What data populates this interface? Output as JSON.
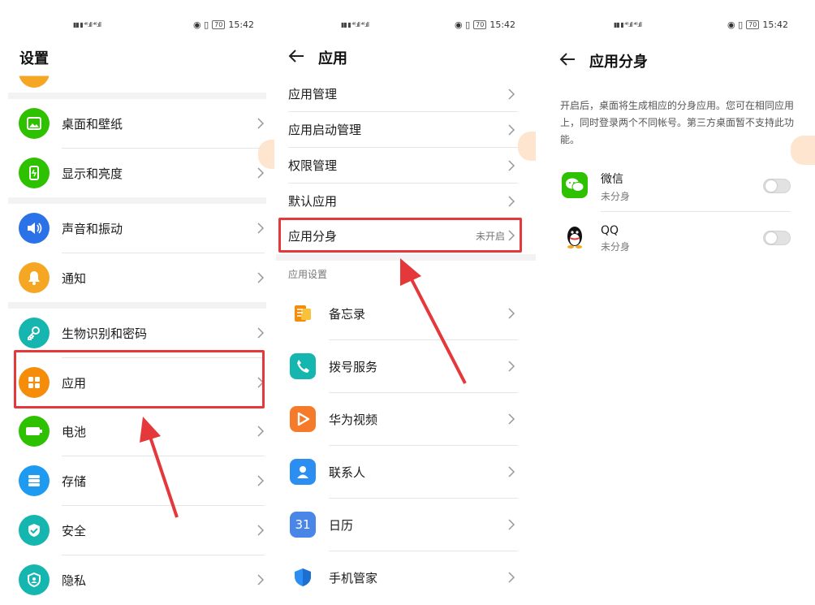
{
  "status": {
    "time": "15:42",
    "battery": "70"
  },
  "panel1": {
    "title": "设置",
    "items": [
      {
        "label": "桌面和壁纸"
      },
      {
        "label": "显示和亮度"
      },
      {
        "label": "声音和振动"
      },
      {
        "label": "通知"
      },
      {
        "label": "生物识别和密码"
      },
      {
        "label": "应用"
      },
      {
        "label": "电池"
      },
      {
        "label": "存储"
      },
      {
        "label": "安全"
      },
      {
        "label": "隐私"
      }
    ]
  },
  "panel2": {
    "title": "应用",
    "menu": [
      {
        "label": "应用管理"
      },
      {
        "label": "应用启动管理"
      },
      {
        "label": "权限管理"
      },
      {
        "label": "默认应用"
      }
    ],
    "clone": {
      "label": "应用分身",
      "value": "未开启"
    },
    "section": "应用设置",
    "apps": [
      {
        "label": "备忘录"
      },
      {
        "label": "拨号服务"
      },
      {
        "label": "华为视频"
      },
      {
        "label": "联系人"
      },
      {
        "label": "日历",
        "icon_text": "31"
      },
      {
        "label": "手机管家"
      }
    ]
  },
  "panel3": {
    "title": "应用分身",
    "description": "开启后，桌面将生成相应的分身应用。您可在相同应用上，同时登录两个不同帐号。第三方桌面暂不支持此功能。",
    "apps": [
      {
        "name": "微信",
        "status": "未分身"
      },
      {
        "name": "QQ",
        "status": "未分身"
      }
    ]
  },
  "colors": {
    "highlight": "#e5383b",
    "wechat": "#2dc100",
    "orange": "#f5a623",
    "blue": "#2b72e8"
  }
}
